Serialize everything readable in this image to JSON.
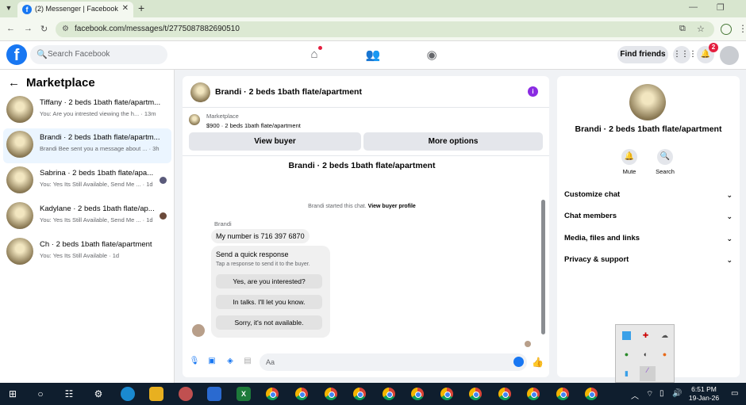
{
  "browser": {
    "tab_title": "(2) Messenger | Facebook",
    "url": "facebook.com/messages/t/2775087882690510"
  },
  "fb_header": {
    "search_placeholder": "Search Facebook",
    "find_friends": "Find friends",
    "notification_count": "2"
  },
  "left": {
    "title": "Marketplace",
    "conversations": [
      {
        "name": "Tiffany · 2 beds 1bath flate/apartm...",
        "snippet": "You: Are you intrested viewing the h... · 13m"
      },
      {
        "name": "Brandi · 2 beds 1bath flate/apartm...",
        "snippet": "Brandi Bee sent you a message about ... · 3h"
      },
      {
        "name": "Sabrina · 2 beds 1bath flate/apa...",
        "snippet": "You: Yes Its Still Available, Send Me ... · 1d"
      },
      {
        "name": "Kadylane · 2 beds 1bath flate/ap...",
        "snippet": "You: Yes Its Still Available, Send Me ... · 1d"
      },
      {
        "name": "Ch · 2 beds 1bath flate/apartment",
        "snippet": "You: Yes Its Still Available · 1d"
      }
    ]
  },
  "chat": {
    "header_title": "Brandi · 2 beds 1bath flate/apartment",
    "marketplace_label": "Marketplace",
    "listing": "$900 · 2 beds 1bath flate/apartment",
    "view_buyer": "View buyer",
    "more_options": "More options",
    "body_title": "Brandi · 2 beds 1bath flate/apartment",
    "started_text": "Brandi started this chat.",
    "view_buyer_profile": "View buyer profile",
    "sender": "Brandi",
    "message": "My number is 716 397 6870",
    "quick_title": "Send a quick response",
    "quick_sub": "Tap a response to send it to the buyer.",
    "quick_options": [
      "Yes, are you interested?",
      "In talks. I'll let you know.",
      "Sorry, it's not available."
    ],
    "composer_placeholder": "Aa"
  },
  "right": {
    "title": "Brandi · 2 beds 1bath flate/apartment",
    "mute": "Mute",
    "search": "Search",
    "sections": [
      "Customize chat",
      "Chat members",
      "Media, files and links",
      "Privacy & support"
    ]
  },
  "taskbar": {
    "time": "6:51 PM",
    "date": "19-Jan-26"
  }
}
